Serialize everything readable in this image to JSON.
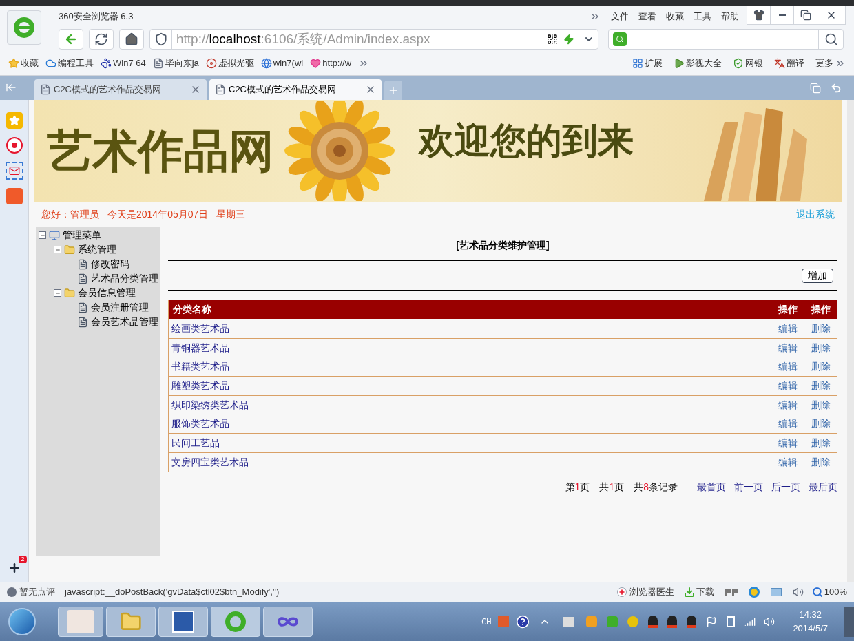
{
  "browser": {
    "title": "360安全浏览器 6.3",
    "menu": [
      "文件",
      "查看",
      "收藏",
      "工具",
      "帮助"
    ],
    "url": {
      "scheme": "http://",
      "host": "localhost",
      "path": ":6106/系统/Admin/index.aspx"
    },
    "bookmarks": [
      {
        "label": "收藏",
        "kind": "star"
      },
      {
        "label": "编程工具",
        "kind": "cloud"
      },
      {
        "label": "Win7 64",
        "kind": "paw"
      },
      {
        "label": "毕向东ja",
        "kind": "page"
      },
      {
        "label": "虚拟光驱",
        "kind": "disc"
      },
      {
        "label": "win7(wi",
        "kind": "globe"
      },
      {
        "label": "http://w",
        "kind": "heart"
      }
    ],
    "tools": [
      {
        "label": "扩展",
        "kind": "grid"
      },
      {
        "label": "影视大全",
        "kind": "play"
      },
      {
        "label": "网银",
        "kind": "shield"
      },
      {
        "label": "翻译",
        "kind": "translate"
      }
    ],
    "more": "更多",
    "tabs": [
      {
        "title": "C2C模式的艺术作品交易网",
        "selected": false
      },
      {
        "title": "C2C模式的艺术作品交易网",
        "selected": true
      }
    ],
    "side_badge": "2"
  },
  "banner": {
    "title": "艺术作品网",
    "welcome": "欢迎您的到来"
  },
  "greeting": {
    "hello": "您好：管理员",
    "date": "今天是2014年05月07日",
    "weekday": "星期三",
    "logout": "退出系统"
  },
  "menu": {
    "label": "管理菜单",
    "expanded": true,
    "children": [
      {
        "label": "系统管理",
        "expanded": true,
        "children": [
          {
            "label": "修改密码"
          },
          {
            "label": "艺术品分类管理"
          }
        ]
      },
      {
        "label": "会员信息管理",
        "expanded": true,
        "children": [
          {
            "label": "会员注册管理"
          },
          {
            "label": "会员艺术品管理"
          }
        ]
      }
    ]
  },
  "page_title": "[艺术品分类维护管理]",
  "add_button": "增加",
  "table": {
    "columns": [
      "分类名称",
      "操作",
      "操作"
    ],
    "rows": [
      {
        "name": "绘画类艺术品",
        "edit": "编辑",
        "delete": "删除"
      },
      {
        "name": "青铜器艺术品",
        "edit": "编辑",
        "delete": "删除"
      },
      {
        "name": "书籍类艺术品",
        "edit": "编辑",
        "delete": "删除"
      },
      {
        "name": "雕塑类艺术品",
        "edit": "编辑",
        "delete": "删除"
      },
      {
        "name": "织印染绣类艺术品",
        "edit": "编辑",
        "delete": "删除"
      },
      {
        "name": "服饰类艺术品",
        "edit": "编辑",
        "delete": "删除"
      },
      {
        "name": "民间工艺品",
        "edit": "编辑",
        "delete": "删除"
      },
      {
        "name": "文房四宝类艺术品",
        "edit": "编辑",
        "delete": "删除"
      }
    ]
  },
  "pager": {
    "counts": [
      {
        "before": "第",
        "number": "1",
        "after": "页"
      },
      {
        "before": "共",
        "number": "1",
        "after": "页"
      },
      {
        "before": "共",
        "number": "8",
        "after": "条记录"
      }
    ],
    "links": [
      "最首页",
      "前一页",
      "后一页",
      "最后页"
    ]
  },
  "status_bar": {
    "rating": "暂无点评",
    "link": "javascript:__doPostBack('gvData$ctl02$btn_Modify','')",
    "doctor": "浏览器医生",
    "download": "下载",
    "zoom": "100%"
  },
  "taskbar": {
    "lang": "CH",
    "time": "14:32",
    "date": "2014/5/7"
  }
}
